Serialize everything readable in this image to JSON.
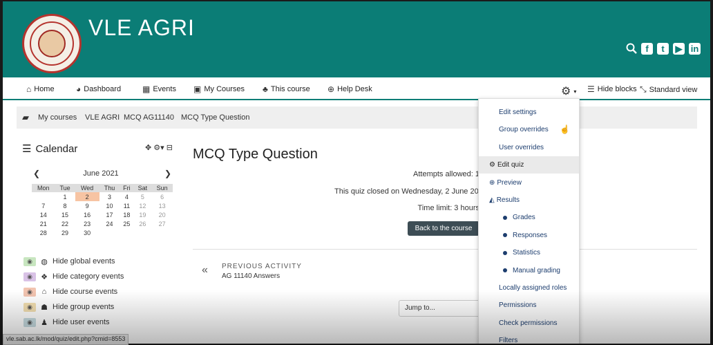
{
  "site": {
    "title": "VLE AGRI",
    "brand_color": "#0b7d76",
    "social_icons": [
      "search-icon",
      "facebook-icon",
      "twitter-icon",
      "youtube-icon",
      "linkedin-icon"
    ]
  },
  "nav": {
    "home": "Home",
    "dashboard": "Dashboard",
    "events": "Events",
    "my_courses": "My Courses",
    "this_course": "This course",
    "help_desk": "Help Desk",
    "hide_blocks": "Hide blocks",
    "standard_view": "Standard view"
  },
  "breadcrumb": [
    "My courses",
    "VLE AGRI",
    "MCQ AG11140",
    "MCQ Type Question"
  ],
  "calendar": {
    "title": "Calendar",
    "month": "June 2021",
    "weekdays": [
      "Mon",
      "Tue",
      "Wed",
      "Thu",
      "Fri",
      "Sat",
      "Sun"
    ],
    "weeks": [
      [
        "",
        "1",
        "2",
        "3",
        "4",
        "5",
        "6"
      ],
      [
        "7",
        "8",
        "9",
        "10",
        "11",
        "12",
        "13"
      ],
      [
        "14",
        "15",
        "16",
        "17",
        "18",
        "19",
        "20"
      ],
      [
        "21",
        "22",
        "23",
        "24",
        "25",
        "26",
        "27"
      ],
      [
        "28",
        "29",
        "30",
        "",
        "",
        "",
        ""
      ]
    ],
    "today": "2"
  },
  "events": [
    {
      "label": "Hide global events",
      "color": "#c8e6c0",
      "icon": "globe-icon"
    },
    {
      "label": "Hide category events",
      "color": "#d9c2e6",
      "icon": "cubes-icon"
    },
    {
      "label": "Hide course events",
      "color": "#f2c4b0",
      "icon": "institution-icon"
    },
    {
      "label": "Hide group events",
      "color": "#f2deb0",
      "icon": "group-icon"
    },
    {
      "label": "Hide user events",
      "color": "#c6dbe0",
      "icon": "user-icon"
    }
  ],
  "main": {
    "title": "MCQ Type Question",
    "attempts": "Attempts allowed: 1",
    "closed": "This quiz closed on Wednesday, 2 June 2021",
    "time_limit": "Time limit: 3 hours",
    "back_button": "Back to the course",
    "prev_label": "PREVIOUS ACTIVITY",
    "prev_name": "AG 11140 Answers",
    "jump_placeholder": "Jump to..."
  },
  "menu": {
    "items": [
      {
        "label": "Edit settings"
      },
      {
        "label": "Group overrides"
      },
      {
        "label": "User overrides"
      },
      {
        "label": "Edit quiz",
        "icon": "gear-icon"
      },
      {
        "label": "Preview",
        "icon": "magnifier-icon"
      },
      {
        "label": "Results",
        "icon": "area-chart-icon"
      },
      {
        "label": "Grades"
      },
      {
        "label": "Responses"
      },
      {
        "label": "Statistics"
      },
      {
        "label": "Manual grading"
      },
      {
        "label": "Locally assigned roles"
      },
      {
        "label": "Permissions"
      },
      {
        "label": "Check permissions"
      },
      {
        "label": "Filters"
      }
    ]
  },
  "status_url": "vle.sab.ac.lk/mod/quiz/edit.php?cmid=8553"
}
